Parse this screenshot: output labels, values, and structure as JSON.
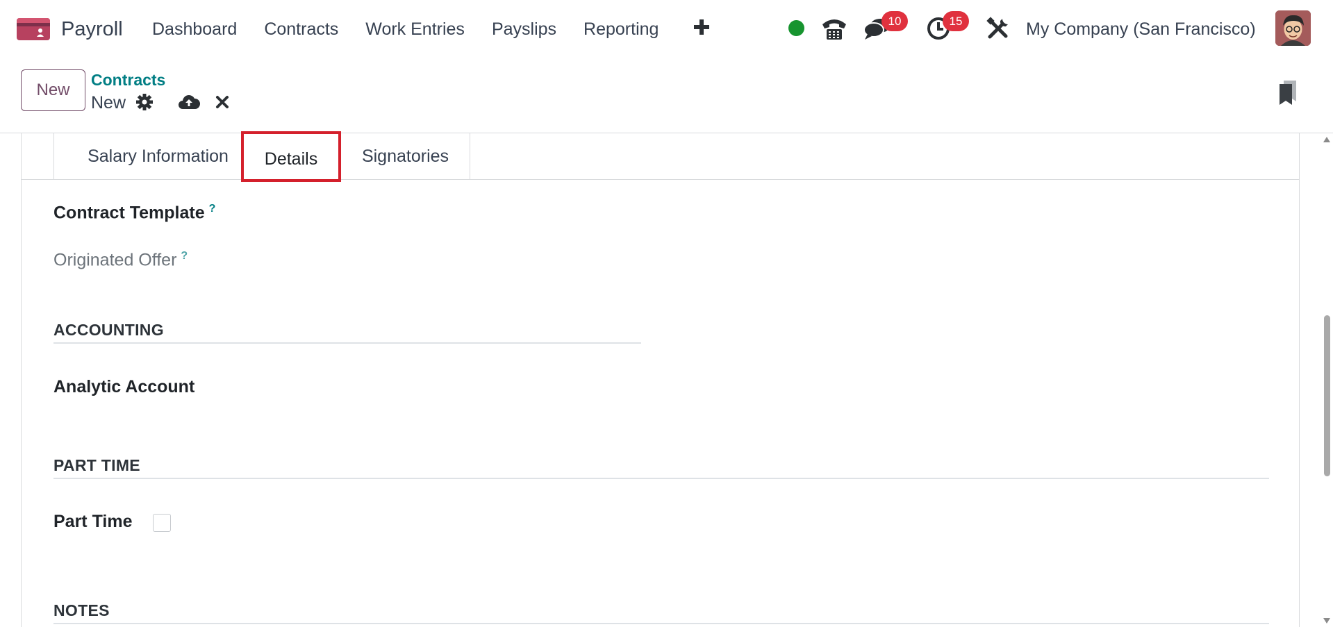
{
  "navbar": {
    "app_name": "Payroll",
    "menu": [
      "Dashboard",
      "Contracts",
      "Work Entries",
      "Payslips",
      "Reporting"
    ],
    "messages_count": "10",
    "activities_count": "15",
    "company": "My Company (San Francisco)",
    "status_color": "#17942f",
    "icons": [
      "app-logo-icon",
      "plus-icon",
      "phone-icon",
      "chat-icon",
      "clock-icon",
      "tools-icon",
      "avatar"
    ]
  },
  "control_panel": {
    "new_button": "New",
    "breadcrumb": "Contracts",
    "record_name": "New",
    "icons": [
      "gear-icon",
      "cloud-upload-icon",
      "close-icon",
      "bookmark-icon"
    ]
  },
  "tabs": [
    {
      "label": "Salary Information",
      "active": false
    },
    {
      "label": "Details",
      "active": true
    },
    {
      "label": "Signatories",
      "active": false
    }
  ],
  "form": {
    "contract_template_label": "Contract Template",
    "contract_template_help": "?",
    "originated_offer_label": "Originated Offer",
    "originated_offer_help": "?",
    "accounting_title": "ACCOUNTING",
    "analytic_account_label": "Analytic Account",
    "part_time_title": "PART TIME",
    "part_time_label": "Part Time",
    "part_time_checked": false,
    "notes_title": "NOTES"
  },
  "colors": {
    "brand": "#714b67",
    "link": "#017e84",
    "badge": "#e0313e",
    "highlight": "#d4202c"
  }
}
